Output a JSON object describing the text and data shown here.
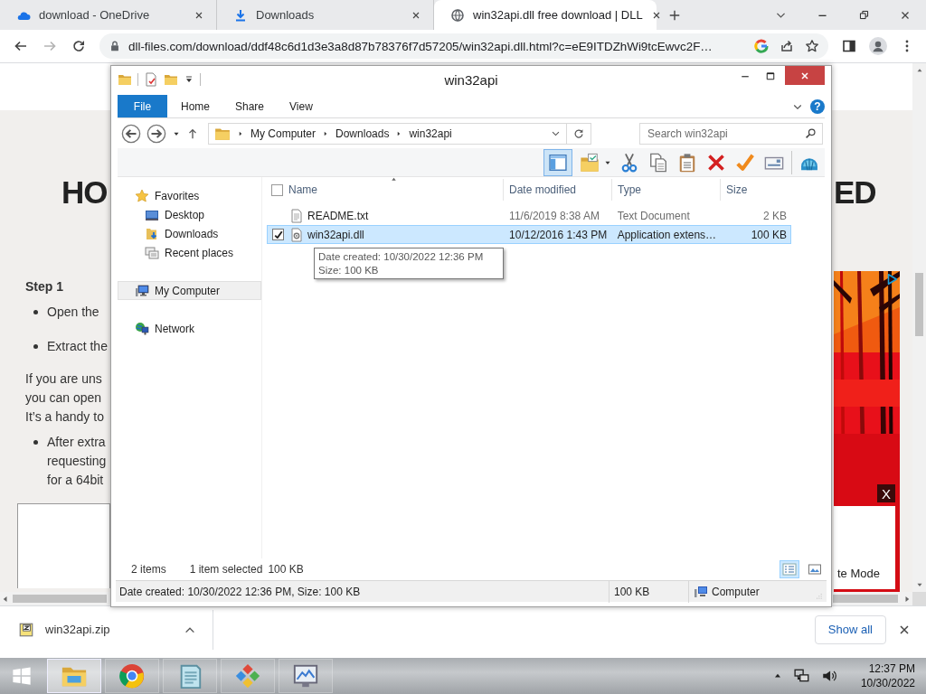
{
  "browser": {
    "tabs": [
      {
        "title": "download - OneDrive",
        "selected": false
      },
      {
        "title": "Downloads",
        "selected": false
      },
      {
        "title": "win32api.dll free download | DLL",
        "selected": true
      }
    ],
    "nav": {
      "forward_disabled": true
    },
    "address": {
      "url": "dll-files.com/download/ddf48c6d1d3e3a8d87b78376f7d57205/win32api.dll.html?c=eE9ITDZhWi9tcEwvc2F…"
    }
  },
  "page": {
    "heading_start": "HO",
    "heading_end": "ED",
    "step": "Step 1",
    "blocks": [
      {
        "kind": "bullet",
        "lines": [
          "Open the"
        ]
      },
      {
        "kind": "bullet",
        "lines": [
          "Extract the"
        ]
      },
      {
        "kind": "paragraph",
        "lines": [
          "If you are uns",
          "you can open",
          "It’s a handy to"
        ]
      },
      {
        "kind": "bullet",
        "lines": [
          "After extra",
          "requesting",
          "for a 64bit"
        ]
      }
    ],
    "ad": {
      "kind": "picture",
      "close": "X"
    },
    "side_box": "te Mode"
  },
  "explorer": {
    "title": "win32api",
    "help": "?",
    "ribbon_tabs": [
      {
        "label": "File",
        "kind": "menu"
      },
      {
        "label": "Home",
        "kind": "tab"
      },
      {
        "label": "Share",
        "kind": "tab"
      },
      {
        "label": "View",
        "kind": "tab"
      }
    ],
    "path": [
      "My Computer",
      "Downloads",
      "win32api"
    ],
    "search": {
      "placeholder": "Search win32api"
    },
    "toolbar": [
      {
        "kind": "preview-pane",
        "selected": true
      },
      {
        "kind": "folder-options",
        "selected": false
      },
      {
        "kind": "cut",
        "selected": false
      },
      {
        "kind": "copy",
        "selected": false
      },
      {
        "kind": "paste",
        "selected": false
      },
      {
        "kind": "delete",
        "selected": false
      },
      {
        "kind": "check",
        "selected": false
      },
      {
        "kind": "card",
        "selected": false
      },
      {
        "kind": "shell",
        "selected": false
      }
    ],
    "nav": [
      {
        "label": "Favorites",
        "selected": false,
        "children": [
          {
            "label": "Desktop",
            "selected": false
          },
          {
            "label": "Downloads",
            "selected": false
          },
          {
            "label": "Recent places",
            "selected": false
          }
        ]
      },
      {
        "label": "My Computer",
        "selected": true
      },
      {
        "label": "Network",
        "selected": false
      }
    ],
    "select_all_checked": false,
    "columns": [
      {
        "label": "Name",
        "sorted": true
      },
      {
        "label": "Date modified",
        "sorted": false
      },
      {
        "label": "Type",
        "sorted": false
      },
      {
        "label": "Size",
        "sorted": false
      }
    ],
    "rows": [
      {
        "kind": "text-file",
        "name": "README.txt",
        "date": "11/6/2019 8:38 AM",
        "type": "Text Document",
        "size": "2 KB",
        "selected": false
      },
      {
        "kind": "library-file",
        "name": "win32api.dll",
        "date": "10/12/2016 1:43 PM",
        "type": "Application extens…",
        "size": "100 KB",
        "selected": true,
        "checked": true
      }
    ],
    "tooltip": [
      "Date created: 10/30/2022 12:36 PM",
      "Size: 100 KB"
    ],
    "item_count": "2 items",
    "selection": "1 item selected",
    "selection_size": "100 KB",
    "views": [
      {
        "kind": "details",
        "selected": true
      },
      {
        "kind": "thumbnails",
        "selected": false
      }
    ],
    "status_bar": {
      "details": "Date created: 10/30/2022 12:36 PM, Size: 100 KB",
      "size": "100 KB",
      "location": "Computer"
    }
  },
  "downloads_bar": {
    "file": "win32api.zip",
    "show_all": "Show all"
  },
  "taskbar": {
    "apps": [
      {
        "kind": "folder",
        "selected": true
      },
      {
        "kind": "round-logo",
        "selected": false
      },
      {
        "kind": "notepad",
        "selected": false
      },
      {
        "kind": "diamonds",
        "selected": false
      },
      {
        "kind": "monitor",
        "selected": false
      }
    ],
    "time": "12:37 PM",
    "date": "10/30/2022"
  }
}
